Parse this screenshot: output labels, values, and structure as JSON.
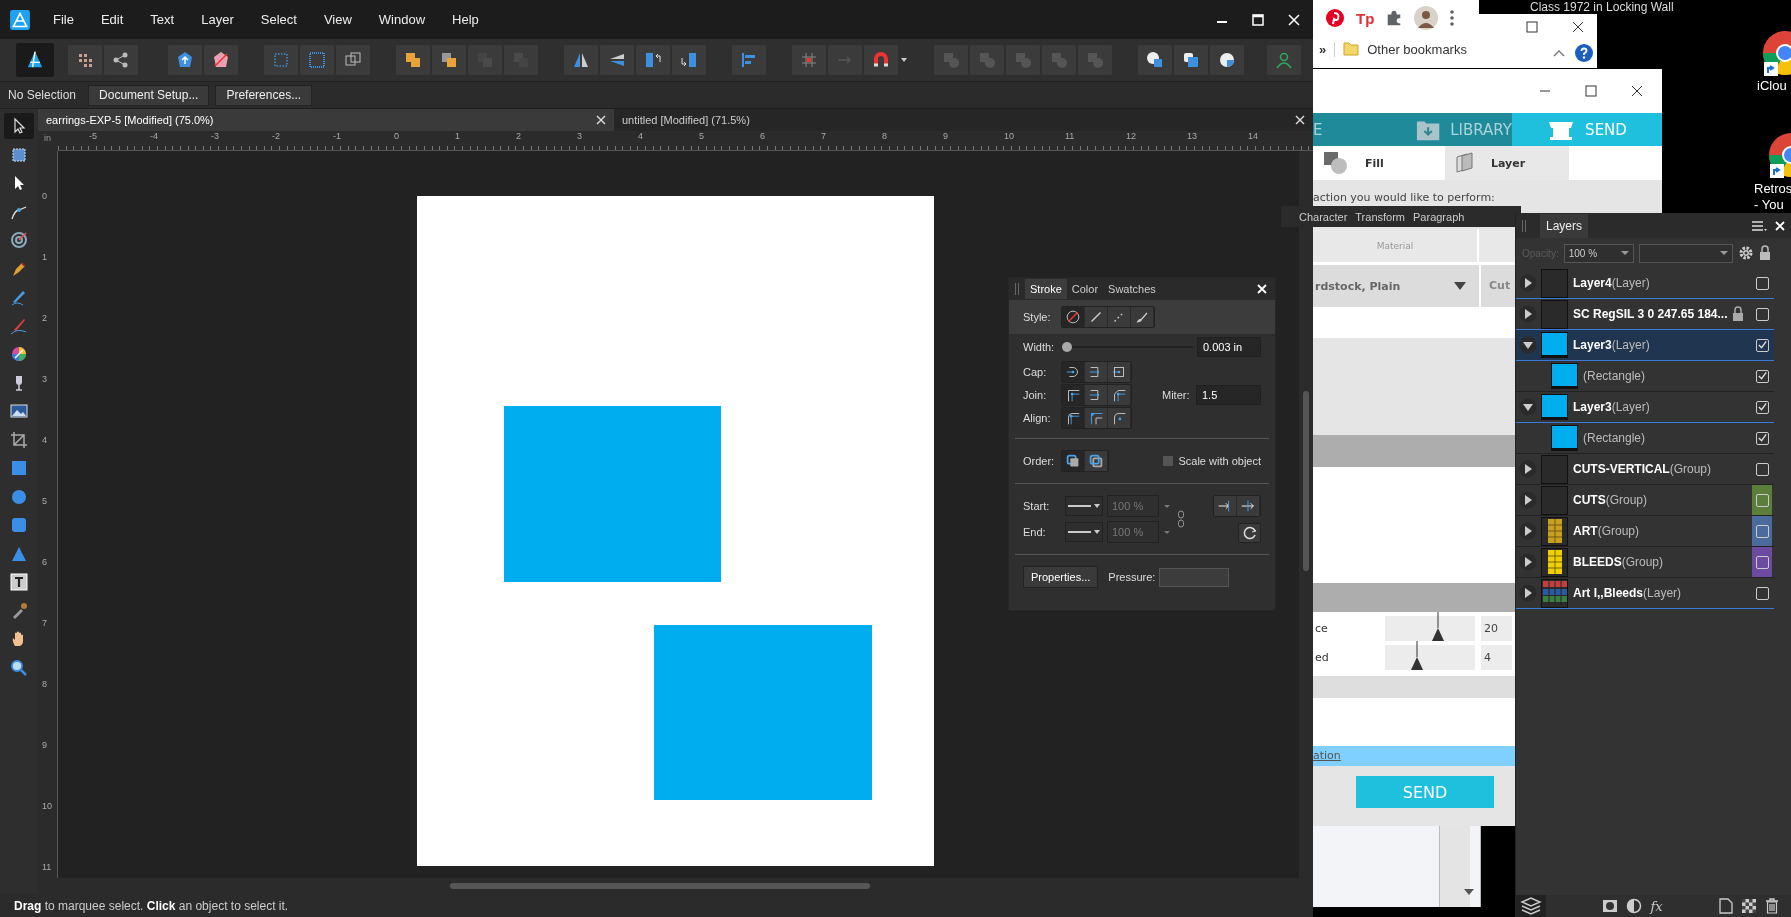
{
  "affinity": {
    "menu": [
      "File",
      "Edit",
      "Text",
      "Layer",
      "Select",
      "View",
      "Window",
      "Help"
    ],
    "context_bar": {
      "status": "No Selection",
      "buttons": [
        "Document Setup...",
        "Preferences..."
      ]
    },
    "tools": [
      {
        "kind": "pointer",
        "selected": true
      },
      {
        "kind": "artboard",
        "selected": false
      },
      {
        "kind": "node",
        "selected": false
      },
      {
        "kind": "corner",
        "selected": false
      },
      {
        "kind": "target",
        "selected": false
      },
      {
        "kind": "pen",
        "selected": false
      },
      {
        "kind": "pencil",
        "selected": false
      },
      {
        "kind": "brush",
        "selected": false
      },
      {
        "kind": "fill",
        "selected": false
      },
      {
        "kind": "glass",
        "selected": false
      },
      {
        "kind": "image",
        "selected": false
      },
      {
        "kind": "crop",
        "selected": false
      },
      {
        "kind": "rect",
        "selected": false
      },
      {
        "kind": "ellipse",
        "selected": false
      },
      {
        "kind": "rounded",
        "selected": false
      },
      {
        "kind": "triangle",
        "selected": false
      },
      {
        "kind": "text",
        "selected": false
      },
      {
        "kind": "picker",
        "selected": false
      },
      {
        "kind": "hand",
        "selected": false
      },
      {
        "kind": "zoom",
        "selected": false
      }
    ],
    "doc_tabs": [
      {
        "label": "earrings-EXP-5 [Modified] (75.0%)",
        "selected": true
      },
      {
        "label": "untitled [Modified] (71.5%)",
        "selected": false
      }
    ],
    "ruler": {
      "unit": "in",
      "h_labels": [
        "-5",
        "-4",
        "-3",
        "-2",
        "-1",
        "0",
        "1",
        "2",
        "3",
        "4",
        "5",
        "6",
        "7",
        "8",
        "9",
        "10",
        "11",
        "12",
        "13",
        "14"
      ],
      "v_labels": [
        "0",
        "1",
        "2",
        "3",
        "4",
        "5",
        "6",
        "7",
        "8",
        "9",
        "10",
        "11"
      ]
    },
    "status_bar": "**Drag** to marquee select. **Click** an object to select it."
  },
  "stroke_panel": {
    "tabs": [
      {
        "label": "Stroke",
        "selected": true
      },
      {
        "label": "Color",
        "selected": false
      },
      {
        "label": "Swatches",
        "selected": false
      }
    ],
    "style": {
      "label": "Style:",
      "options": [
        {
          "kind": "none",
          "selected": true
        },
        {
          "kind": "solid",
          "selected": false
        },
        {
          "kind": "dashed",
          "selected": false
        },
        {
          "kind": "brush",
          "selected": false
        }
      ]
    },
    "width": {
      "label": "Width:",
      "level": 0,
      "value": "0.003 in"
    },
    "cap": {
      "label": "Cap:",
      "options": [
        {
          "kind": "butt",
          "selected": true
        },
        {
          "kind": "round",
          "selected": false
        },
        {
          "kind": "square",
          "selected": false
        }
      ]
    },
    "join": {
      "label": "Join:",
      "options": [
        {
          "kind": "miter",
          "selected": true
        },
        {
          "kind": "round",
          "selected": false
        },
        {
          "kind": "bevel",
          "selected": false
        }
      ]
    },
    "miter": {
      "label": "Miter:",
      "value": "1.5"
    },
    "align": {
      "label": "Align:",
      "options": [
        {
          "kind": "center",
          "selected": true
        },
        {
          "kind": "inside",
          "selected": false
        },
        {
          "kind": "outside",
          "selected": false
        }
      ]
    },
    "order": {
      "label": "Order:",
      "options": [
        {
          "kind": "behind",
          "selected": true
        },
        {
          "kind": "front",
          "selected": false
        }
      ]
    },
    "scale_with_object": {
      "label": "Scale with object",
      "checked": false
    },
    "start": {
      "label": "Start:",
      "scale": "100 %",
      "disabled": true
    },
    "end": {
      "label": "End:",
      "scale": "100 %",
      "disabled": true
    },
    "properties_button": "Properties...",
    "pressure_label": "Pressure:"
  },
  "character_bar": [
    "Character",
    "Transform",
    "Paragraph"
  ],
  "layers_panel": {
    "title": "Layers",
    "opacity": {
      "label": "Opacity:",
      "value": "100 %",
      "disabled": true
    },
    "layers": [
      {
        "kind": "layer",
        "name": "Layer4",
        "type": "(Layer)",
        "thumbnail": {
          "kind": "empty"
        },
        "expanded": false,
        "visible": false,
        "locked": false,
        "selected": false
      },
      {
        "kind": "layer",
        "name": "SC RegSIL 3 0 247.65 184...",
        "thumbnail": {
          "kind": "empty"
        },
        "expanded": false,
        "visible": false,
        "locked": true,
        "selected": false
      },
      {
        "kind": "layer",
        "name": "Layer3",
        "type": "(Layer)",
        "thumbnail": {
          "kind": "blue"
        },
        "expanded": true,
        "visible": true,
        "locked": false,
        "selected": true,
        "children": [
          {
            "type": "(Rectangle)",
            "thumbnail": {
              "kind": "blue"
            },
            "visible": true,
            "selected": false
          }
        ]
      },
      {
        "kind": "layer",
        "name": "Layer3",
        "type": "(Layer)",
        "thumbnail": {
          "kind": "blue"
        },
        "expanded": true,
        "visible": true,
        "locked": false,
        "selected": false,
        "children": [
          {
            "type": "(Rectangle)",
            "thumbnail": {
              "kind": "blue"
            },
            "visible": true,
            "selected": false
          }
        ]
      },
      {
        "kind": "group",
        "name": "CUTS-VERTICAL",
        "type": "(Group)",
        "thumbnail": {
          "kind": "empty"
        },
        "expanded": false,
        "visible": false,
        "locked": false,
        "selected": false
      },
      {
        "kind": "group",
        "name": "CUTS",
        "type": "(Group)",
        "thumbnail": {
          "kind": "empty"
        },
        "expanded": false,
        "visible": false,
        "locked": false,
        "selected": false,
        "color": "#5b7f3a"
      },
      {
        "kind": "group",
        "name": "ART",
        "type": "(Group)",
        "thumbnail": {
          "kind": "art"
        },
        "expanded": false,
        "visible": false,
        "locked": false,
        "selected": false,
        "color": "#4a6b9c"
      },
      {
        "kind": "group",
        "name": "BLEEDS",
        "type": "(Group)",
        "thumbnail": {
          "kind": "bleeds"
        },
        "expanded": false,
        "visible": false,
        "locked": false,
        "selected": false,
        "color": "#6b4a9f"
      },
      {
        "kind": "layer",
        "name": "Art I,,Bleeds",
        "type": "(Layer)",
        "thumbnail": {
          "kind": "mixed"
        },
        "expanded": false,
        "visible": false,
        "locked": false,
        "selected": false
      }
    ],
    "footer_text": "fx"
  },
  "cricut": {
    "nav": [
      {
        "kind": "text",
        "label": "E",
        "selected": false
      },
      {
        "kind": "library",
        "label": "LIBRARY",
        "selected": false
      },
      {
        "kind": "send",
        "label": "SEND",
        "selected": true
      }
    ],
    "tabs": [
      {
        "kind": "fill",
        "label": "Fill",
        "selected": false
      },
      {
        "kind": "layer",
        "label": "Layer",
        "selected": true
      }
    ],
    "prompt": "action you would like to perform:",
    "table_header": "Material",
    "material": "rdstock, Plain",
    "action": "Cut",
    "sliders": [
      {
        "label": "ce",
        "level": 0.59,
        "value": "20"
      },
      {
        "label": "ed",
        "level": 0.35,
        "value": "4"
      }
    ],
    "link": "ation",
    "send_button": "SEND"
  },
  "browser": {
    "extension_text": "Tp",
    "overflow": "»",
    "bookmarks": "Other bookmarks"
  },
  "desktop": {
    "caption": "Class 1972 in Locking Wall",
    "icons": [
      {
        "lines": [
          "iClou"
        ]
      },
      {
        "lines": [
          "Retros",
          "- You"
        ]
      }
    ]
  }
}
